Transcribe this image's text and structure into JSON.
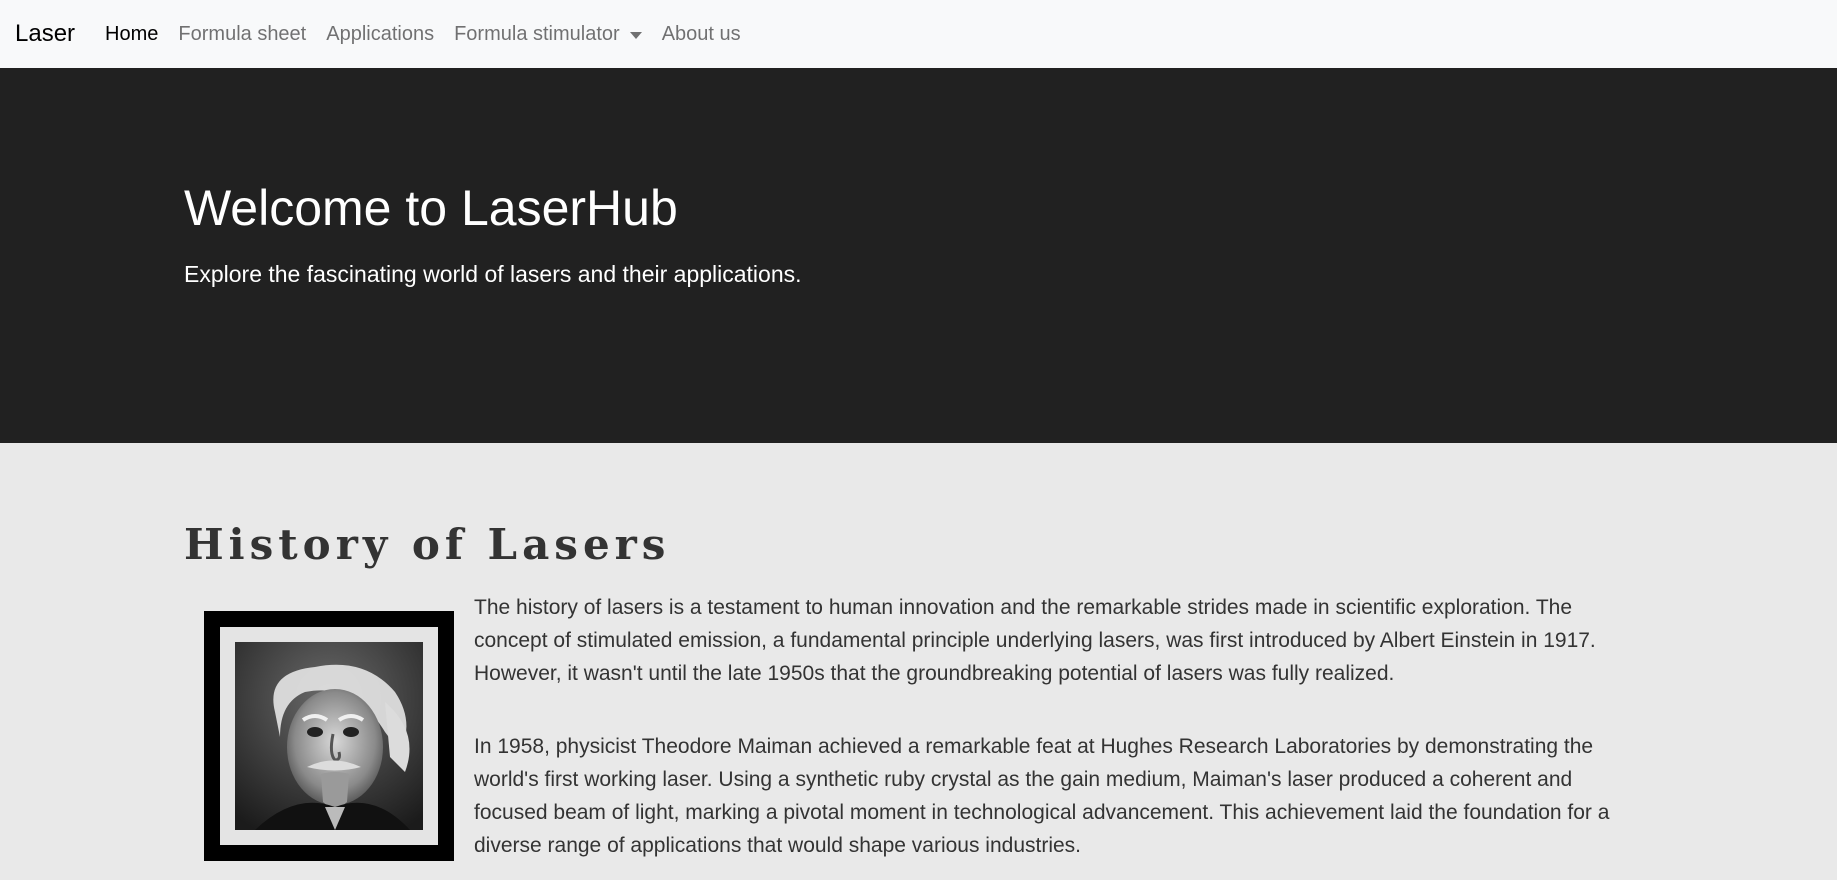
{
  "navbar": {
    "brand": "Laser",
    "items": [
      {
        "label": "Home",
        "active": true
      },
      {
        "label": "Formula sheet"
      },
      {
        "label": "Applications"
      },
      {
        "label": "Formula stimulator",
        "dropdown": true
      },
      {
        "label": "About us"
      }
    ]
  },
  "hero": {
    "title": "Welcome to LaserHub",
    "subtitle": "Explore the fascinating world of lasers and their applications."
  },
  "history": {
    "title": "History of Lasers",
    "paragraphs": [
      "The history of lasers is a testament to human innovation and the remarkable strides made in scientific exploration. The concept of stimulated emission, a fundamental principle underlying lasers, was first introduced by Albert Einstein in 1917. However, it wasn't until the late 1950s that the groundbreaking potential of lasers was fully realized.",
      "In 1958, physicist Theodore Maiman achieved a remarkable feat at Hughes Research Laboratories by demonstrating the world's first working laser. Using a synthetic ruby crystal as the gain medium, Maiman's laser produced a coherent and focused beam of light, marking a pivotal moment in technological advancement. This achievement laid the foundation for a diverse range of applications that would shape various industries."
    ]
  },
  "colors": {
    "navbar_bg": "#f8f9fa",
    "hero_bg": "#212121",
    "page_bg": "#e9e9e9",
    "text": "#333333"
  }
}
